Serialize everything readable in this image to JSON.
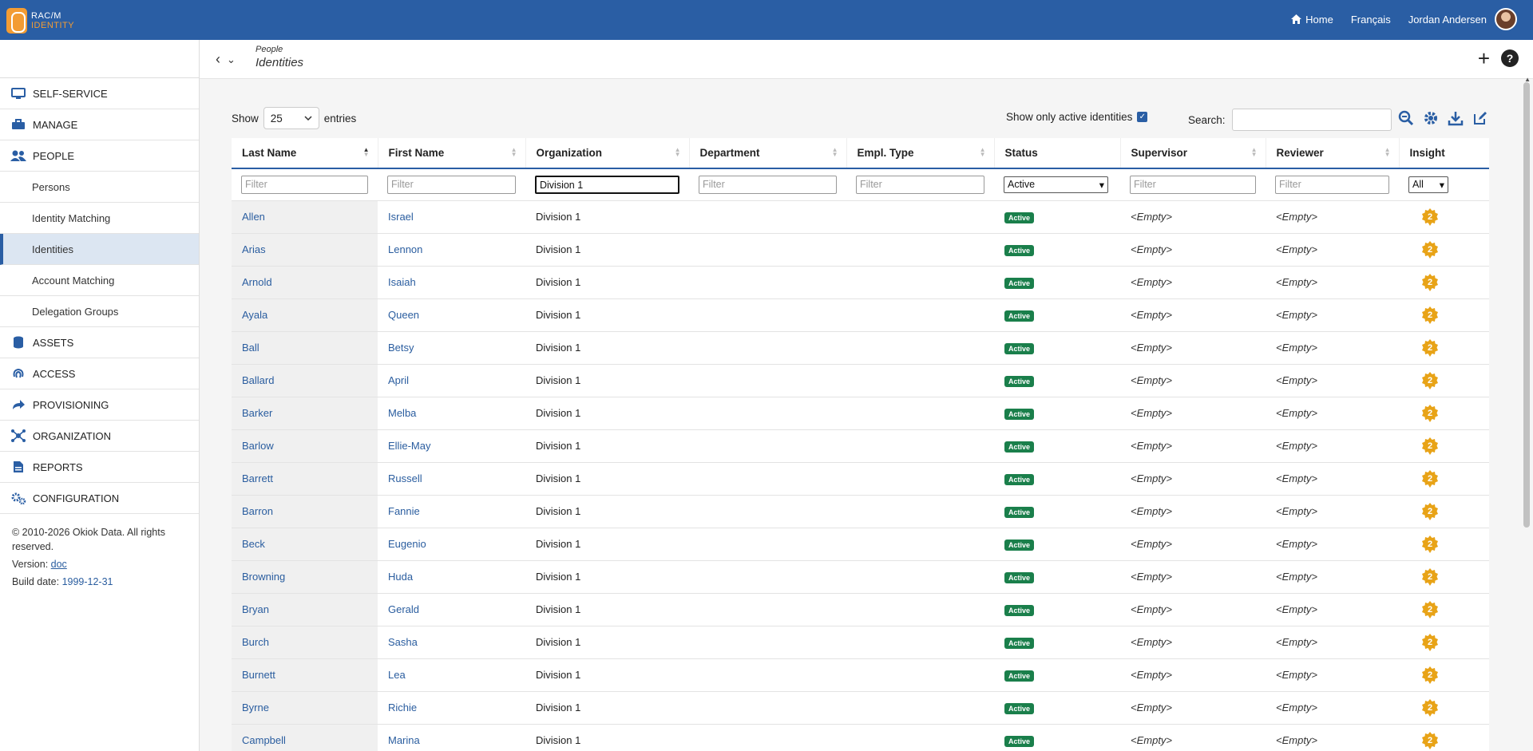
{
  "app": {
    "logo_line1": "RAC/M",
    "logo_line2": "IDENTITY"
  },
  "topnav": {
    "home": "Home",
    "language": "Français",
    "user": "Jordan Andersen"
  },
  "sidebar": {
    "items": [
      {
        "label": "SELF-SERVICE",
        "icon": "monitor-icon"
      },
      {
        "label": "MANAGE",
        "icon": "toolbox-icon"
      },
      {
        "label": "PEOPLE",
        "icon": "people-icon"
      }
    ],
    "people_sub": [
      "Persons",
      "Identity Matching",
      "Identities",
      "Account Matching",
      "Delegation Groups"
    ],
    "items2": [
      {
        "label": "ASSETS",
        "icon": "database-icon"
      },
      {
        "label": "ACCESS",
        "icon": "fingerprint-icon"
      },
      {
        "label": "PROVISIONING",
        "icon": "share-icon"
      },
      {
        "label": "ORGANIZATION",
        "icon": "network-icon"
      },
      {
        "label": "REPORTS",
        "icon": "report-icon"
      },
      {
        "label": "CONFIGURATION",
        "icon": "gears-icon"
      }
    ],
    "footer": {
      "copyright": "© 2010-2026 Okiok Data. All rights reserved.",
      "version_label": "Version:",
      "version": "doc",
      "build_label": "Build date:",
      "build_date": "1999-12-31"
    }
  },
  "breadcrumb": {
    "parent": "People",
    "current": "Identities"
  },
  "controls": {
    "show_label": "Show",
    "entries_value": "25",
    "entries_label": "entries",
    "active_only_label": "Show only active identities",
    "search_label": "Search:"
  },
  "table": {
    "columns": [
      "Last Name",
      "First Name",
      "Organization",
      "Department",
      "Empl. Type",
      "Status",
      "Supervisor",
      "Reviewer",
      "Insight"
    ],
    "filters": {
      "placeholder": "Filter",
      "organization": "Division 1",
      "status": "Active",
      "insight": "All"
    },
    "rows": [
      [
        "Allen",
        "Israel"
      ],
      [
        "Arias",
        "Lennon"
      ],
      [
        "Arnold",
        "Isaiah"
      ],
      [
        "Ayala",
        "Queen"
      ],
      [
        "Ball",
        "Betsy"
      ],
      [
        "Ballard",
        "April"
      ],
      [
        "Barker",
        "Melba"
      ],
      [
        "Barlow",
        "Ellie-May"
      ],
      [
        "Barrett",
        "Russell"
      ],
      [
        "Barron",
        "Fannie"
      ],
      [
        "Beck",
        "Eugenio"
      ],
      [
        "Browning",
        "Huda"
      ],
      [
        "Bryan",
        "Gerald"
      ],
      [
        "Burch",
        "Sasha"
      ],
      [
        "Burnett",
        "Lea"
      ],
      [
        "Byrne",
        "Richie"
      ],
      [
        "Campbell",
        "Marina"
      ]
    ],
    "row_organization": "Division 1",
    "row_status": "Active",
    "row_supervisor": "<Empty>",
    "row_reviewer": "<Empty>",
    "row_insight": "2"
  },
  "colors": {
    "brand": "#2a5ea4",
    "accent": "#f39c33",
    "active_badge": "#1a7f4b",
    "insight": "#e8a317"
  }
}
